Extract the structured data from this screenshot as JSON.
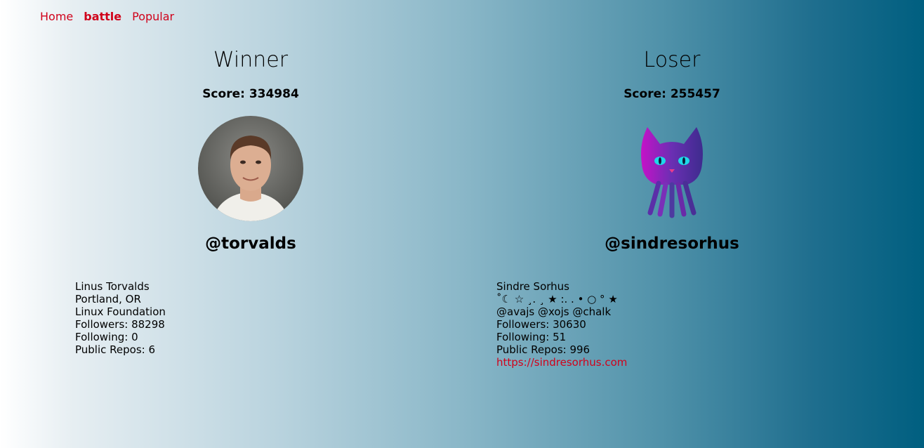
{
  "nav": {
    "items": [
      {
        "label": "Home"
      },
      {
        "label": "battle"
      },
      {
        "label": "Popular"
      }
    ]
  },
  "players": [
    {
      "result": "Winner",
      "score": "Score: 334984",
      "handle": "@torvalds",
      "info": {
        "name": "Linus Torvalds",
        "location": "Portland, OR",
        "company": "Linux Foundation",
        "followers": "Followers: 88298",
        "following": "Following: 0",
        "repos": "Public Repos: 6"
      }
    },
    {
      "result": "Loser",
      "score": "Score: 255457",
      "handle": "@sindresorhus",
      "info": {
        "name": "Sindre Sorhus",
        "bio": "˚☾ ☆ ¸. ¸  ★ :.  . • ○ ° ★",
        "company": "@avajs @xojs @chalk",
        "followers": "Followers: 30630",
        "following": "Following: 51",
        "repos": "Public Repos: 996",
        "blog": "https://sindresorhus.com"
      }
    }
  ],
  "colors": {
    "link": "#d0021b",
    "gradient_start": "#ffffff",
    "gradient_end": "#005f80"
  }
}
